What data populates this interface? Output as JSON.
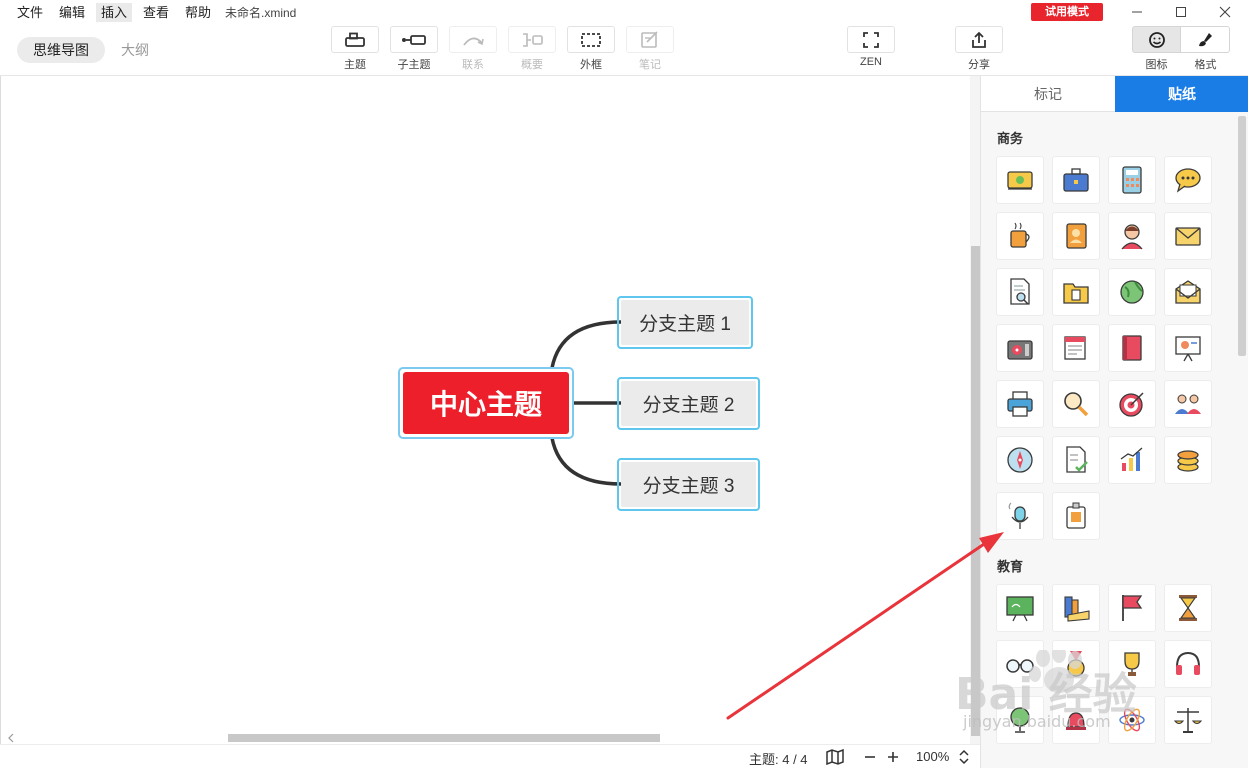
{
  "menu": {
    "items": [
      {
        "label": "文件",
        "active": false
      },
      {
        "label": "编辑",
        "active": false
      },
      {
        "label": "插入",
        "active": true
      },
      {
        "label": "查看",
        "active": false
      },
      {
        "label": "帮助",
        "active": false
      }
    ],
    "file_name": "未命名.xmind",
    "trial_badge": "试用模式"
  },
  "views": {
    "mindmap": "思维导图",
    "outline": "大纲"
  },
  "toolbar": {
    "topic": "主题",
    "subtopic": "子主题",
    "relationship": "联系",
    "summary": "概要",
    "boundary": "外框",
    "notes": "笔记",
    "zen": "ZEN",
    "share": "分享",
    "icons_panel": "图标",
    "format_panel": "格式"
  },
  "mindmap": {
    "central": "中心主题",
    "branches": [
      "分支主题 1",
      "分支主题 2",
      "分支主题 3"
    ]
  },
  "status": {
    "topic_count": "主题: 4 / 4",
    "zoom": "100%"
  },
  "panel": {
    "tabs": {
      "markers": "标记",
      "stickers": "贴纸"
    },
    "sections": [
      {
        "title": "商务",
        "stickers": [
          "money-icon",
          "briefcase-icon",
          "calculator-icon",
          "chat-bubble-icon",
          "coffee-cup-icon",
          "contact-card-icon",
          "support-agent-icon",
          "envelope-icon",
          "document-search-icon",
          "folder-icon",
          "globe-icon",
          "open-mail-icon",
          "cash-register-icon",
          "newspaper-icon",
          "book-icon",
          "presentation-board-icon",
          "printer-icon",
          "magnifier-icon",
          "target-icon",
          "team-icon",
          "compass-icon",
          "checklist-icon",
          "bar-chart-icon",
          "coins-icon",
          "microphone-icon",
          "id-badge-icon"
        ]
      },
      {
        "title": "教育",
        "stickers": [
          "chalkboard-icon",
          "books-icon",
          "flag-icon",
          "hourglass-icon",
          "glasses-icon",
          "medal-icon",
          "trophy-icon",
          "headphones-icon",
          "globe-stand-icon",
          "bell-icon",
          "atom-icon",
          "scales-icon"
        ]
      }
    ]
  },
  "watermark": {
    "brand": "Bai 经验",
    "url": "jingyan.baidu.com"
  },
  "colors": {
    "central_topic": "#ec1f2b",
    "branch_fill": "#ebebeb",
    "branch_border": "#5fc6ee",
    "accent_blue": "#1a7de6",
    "trial_red": "#e8242d",
    "arrow_red": "#e8343a"
  }
}
